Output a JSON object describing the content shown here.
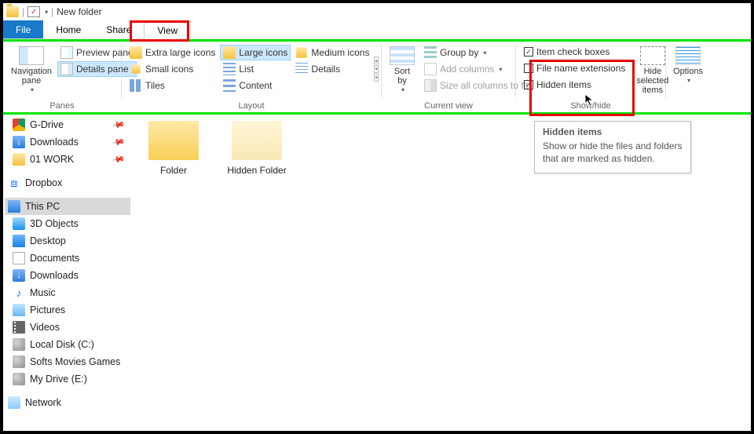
{
  "title": "New folder",
  "tabs": {
    "file": "File",
    "home": "Home",
    "share": "Share",
    "view": "View"
  },
  "ribbon": {
    "panes": {
      "label": "Panes",
      "nav": "Navigation pane",
      "preview": "Preview pane",
      "details": "Details pane"
    },
    "layout": {
      "label": "Layout",
      "xl": "Extra large icons",
      "large": "Large icons",
      "medium": "Medium icons",
      "small": "Small icons",
      "list": "List",
      "details": "Details",
      "tiles": "Tiles",
      "content": "Content"
    },
    "view": {
      "label": "Current view",
      "sort": "Sort by",
      "group": "Group by",
      "addcols": "Add columns",
      "sizecols": "Size all columns to fit"
    },
    "showhide": {
      "label": "Show/hide",
      "checkboxes": "Item check boxes",
      "ext": "File name extensions",
      "hidden": "Hidden items",
      "hidesel": "Hide selected items"
    },
    "options": "Options"
  },
  "tree": {
    "g": "G-Drive",
    "downloads": "Downloads",
    "work": "01 WORK",
    "dropbox": "Dropbox",
    "thispc": "This PC",
    "threed": "3D Objects",
    "desktop": "Desktop",
    "documents": "Documents",
    "dl2": "Downloads",
    "music": "Music",
    "pictures": "Pictures",
    "videos": "Videos",
    "cdrive": "Local Disk (C:)",
    "softs": "Softs Movies Games",
    "edrive": "My Drive (E:)",
    "network": "Network"
  },
  "items": {
    "folder": "Folder",
    "hidden": "Hidden Folder"
  },
  "tooltip": {
    "title": "Hidden items",
    "body": "Show or hide the files and folders that are marked as hidden."
  }
}
